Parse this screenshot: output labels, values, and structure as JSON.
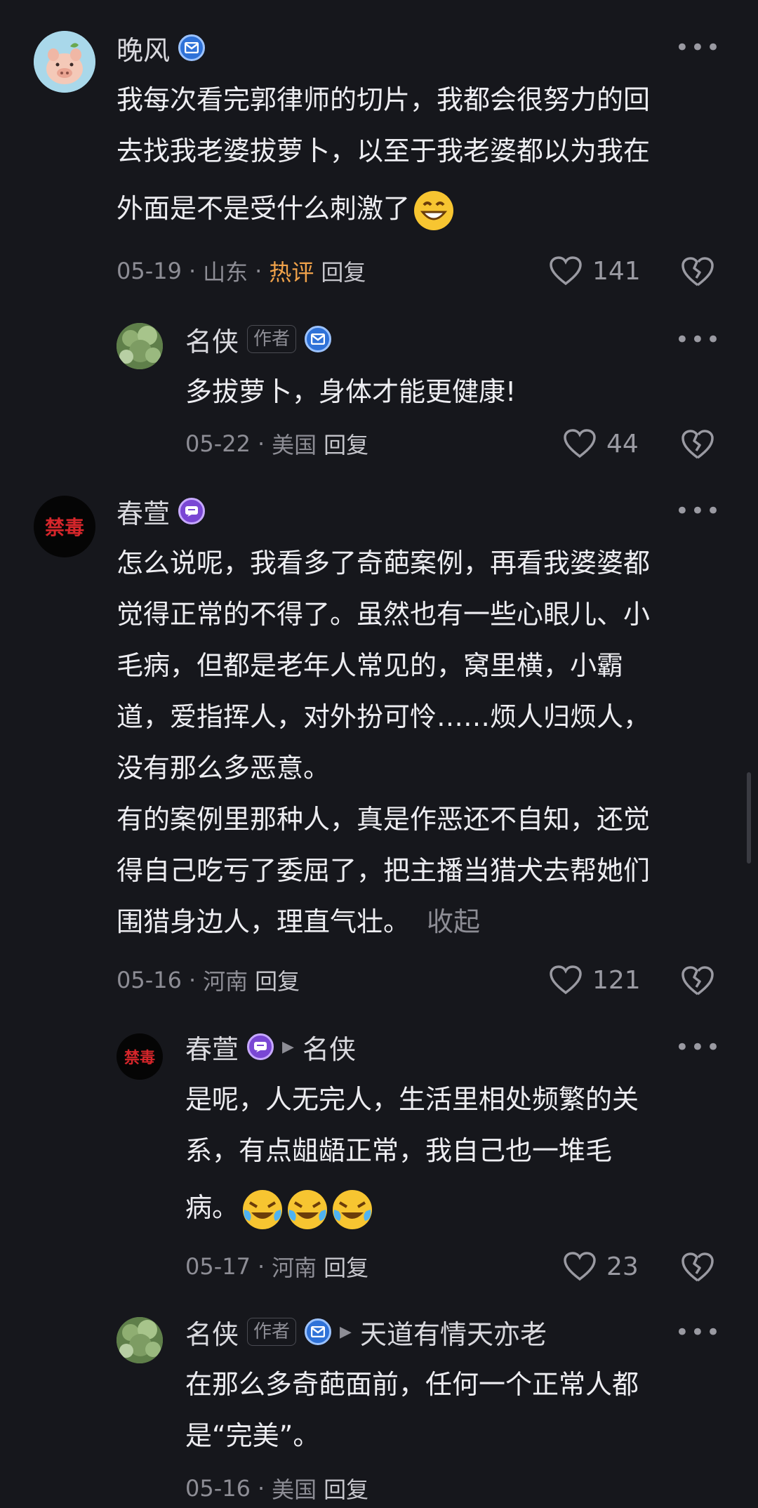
{
  "comments": [
    {
      "name": "晚风",
      "text": [
        "我每次看完郭律师的切片，我都会很努力的回",
        "去找我老婆拔萝卜，以至于我老婆都以为我在",
        "外面是不是受什么刺激了"
      ],
      "date": "05-19",
      "location": "山东",
      "hot_label": "热评",
      "reply_label": "回复",
      "likes": "141"
    },
    {
      "name": "名侠",
      "author_tag": "作者",
      "text": [
        "多拔萝卜，身体才能更健康!"
      ],
      "date": "05-22",
      "location": "美国",
      "reply_label": "回复",
      "likes": "44"
    },
    {
      "name": "春萱",
      "avatar_text": "禁毒",
      "text": [
        "怎么说呢，我看多了奇葩案例，再看我婆婆都",
        "觉得正常的不得了。虽然也有一些心眼儿、小",
        "毛病，但都是老年人常见的，窝里横，小霸",
        "道，爱指挥人，对外扮可怜……烦人归烦人，",
        "没有那么多恶意。",
        "有的案例里那种人，真是作恶还不自知，还觉",
        "得自己吃亏了委屈了，把主播当猎犬去帮她们",
        "围猎身边人，理直气壮。"
      ],
      "collapse_label": "收起",
      "date": "05-16",
      "location": "河南",
      "reply_label": "回复",
      "likes": "121"
    },
    {
      "name": "春萱",
      "avatar_text": "禁毒",
      "reply_to": "名侠",
      "text": [
        "是呢，人无完人，生活里相处频繁的关",
        "系，有点龃龉正常，我自己也一堆毛",
        "病。"
      ],
      "date": "05-17",
      "location": "河南",
      "reply_label": "回复",
      "likes": "23"
    },
    {
      "name": "名侠",
      "author_tag": "作者",
      "reply_to": "天道有情天亦老",
      "text": [
        "在那么多奇葩面前，任何一个正常人都",
        "是“完美”。"
      ],
      "date": "05-16",
      "location": "美国",
      "reply_label": "回复"
    }
  ],
  "icons": {
    "more": "more-dots-icon",
    "like": "heart-icon",
    "dislike": "broken-heart-icon",
    "verified": "verified-badge-icon",
    "member": "member-badge-icon"
  },
  "colors": {
    "background": "#16171c",
    "hot": "#f0a24a",
    "verified": "#2f72d8",
    "member": "#7a47d4"
  }
}
